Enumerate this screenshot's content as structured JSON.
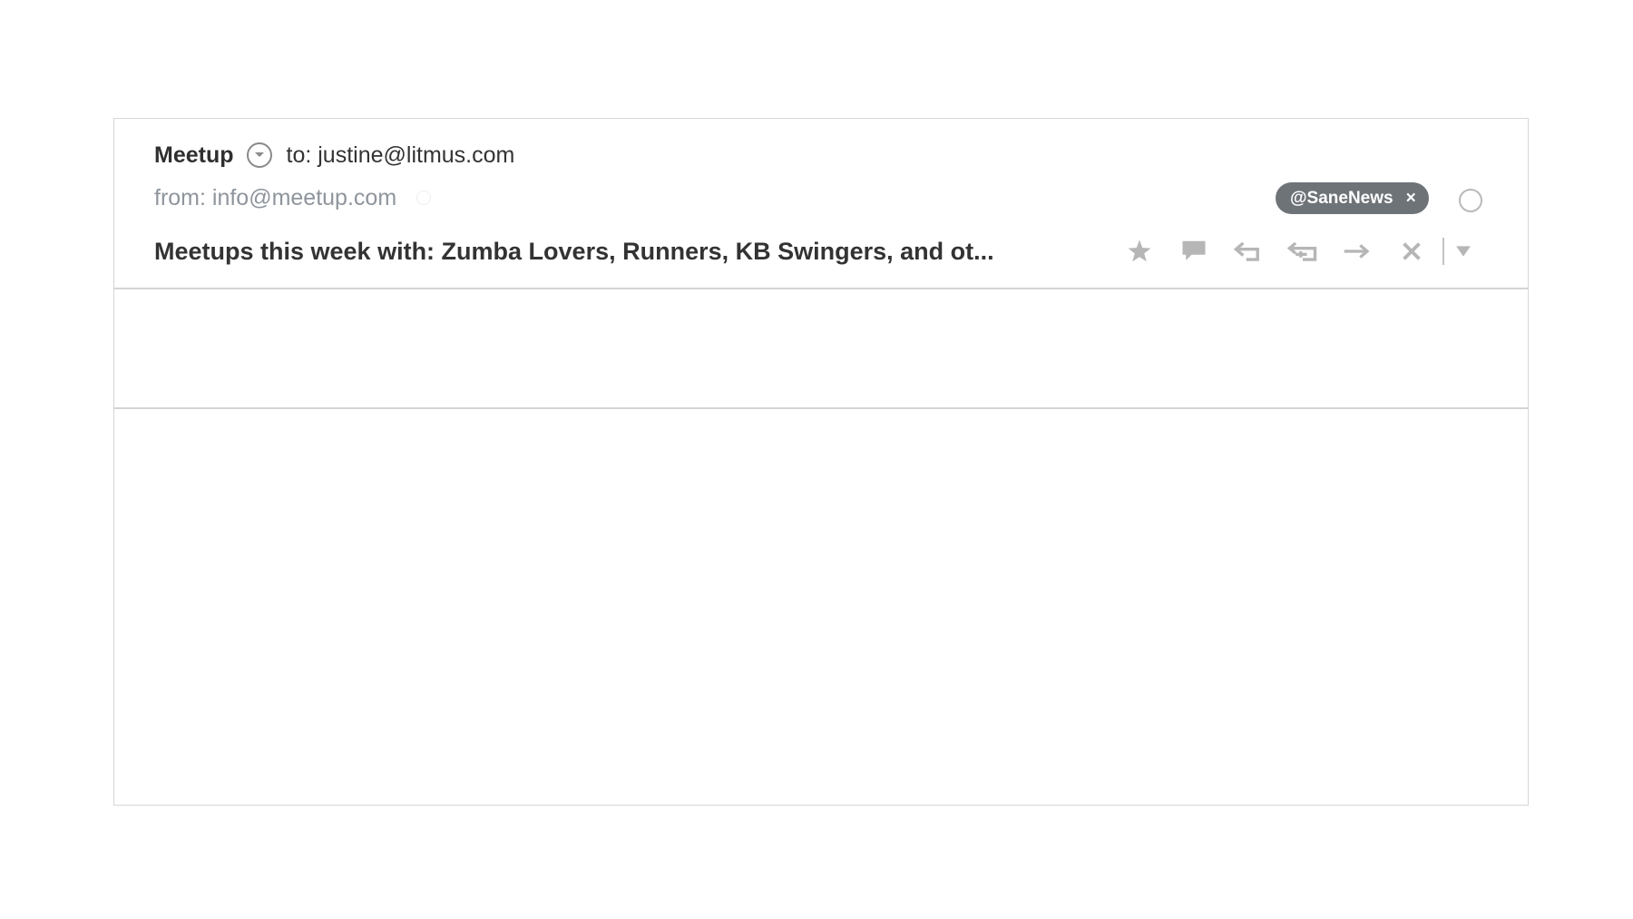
{
  "message": {
    "sender_name": "Meetup",
    "to_line": "to: justine@litmus.com",
    "from_line": "from: info@meetup.com",
    "subject": "Meetups this week with: Zumba Lovers, Runners, KB Swingers, and ot..."
  },
  "tag": {
    "label": "@SaneNews",
    "remove_glyph": "×",
    "color": "#6e7378"
  },
  "actions": [
    {
      "icon": "star-icon"
    },
    {
      "icon": "comment-icon"
    },
    {
      "icon": "reply-icon"
    },
    {
      "icon": "reply-all-icon"
    },
    {
      "icon": "forward-icon"
    },
    {
      "icon": "delete-icon"
    },
    {
      "icon": "more-dropdown-icon"
    }
  ],
  "colors": {
    "icon_gray": "#b6b6b6",
    "from_gray": "#8f959c",
    "border": "#d4d4d4"
  }
}
